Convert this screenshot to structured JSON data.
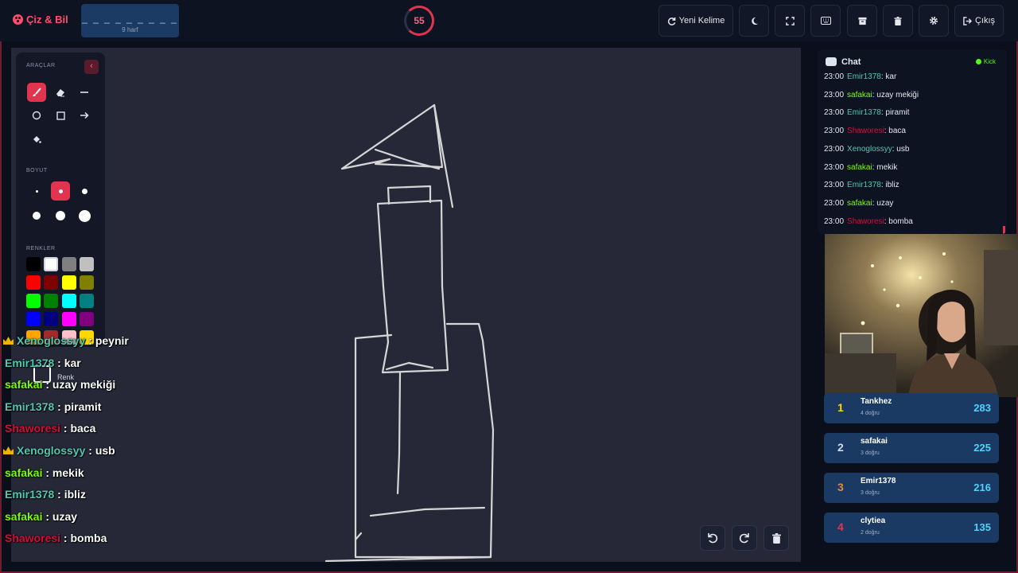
{
  "app": {
    "title": "Çiz & Bil"
  },
  "word": {
    "dashes": "_ _ _ _ _ _ _ _ _",
    "count_label": "9 harf"
  },
  "timer": {
    "seconds": "55"
  },
  "header_buttons": {
    "new_word": "Yeni Kelime",
    "exit": "Çıkış"
  },
  "tools_panel": {
    "tools_label": "ARAÇLAR",
    "size_label": "BOYUT",
    "colors_label": "RENKLER",
    "color_label": "Renk",
    "active_tool": "brush-icon",
    "tools": [
      "brush-icon",
      "eraser-icon",
      "line-icon",
      "circle-icon",
      "rectangle-icon",
      "arrow-icon",
      "fill-bucket-icon"
    ],
    "active_size_index": 1,
    "swatches": [
      "#000000",
      "#ffffff",
      "#808080",
      "#c0c0c0",
      "#ff0000",
      "#800000",
      "#ffff00",
      "#808000",
      "#00ff00",
      "#008000",
      "#00ffff",
      "#008080",
      "#0000ff",
      "#000080",
      "#ff00ff",
      "#800080",
      "#ffa500",
      "#a52a2a",
      "#ffc0cb",
      "#ffd700"
    ]
  },
  "overlay_chat": [
    {
      "user": "Xenoglossyy",
      "text": ": peynir",
      "color": "#4ec9b0",
      "crown": true
    },
    {
      "user": "Emir1378",
      "text": ": kar",
      "color": "#4ec9b0",
      "crown": false
    },
    {
      "user": "safakai",
      "text": ": uzay mekiği",
      "color": "#7cfc00",
      "crown": false
    },
    {
      "user": "Emir1378",
      "text": ": piramit",
      "color": "#4ec9b0",
      "crown": false
    },
    {
      "user": "Shaworesi",
      "text": ": baca",
      "color": "#d0103a",
      "crown": false
    },
    {
      "user": "Xenoglossyy",
      "text": ": usb",
      "color": "#4ec9b0",
      "crown": true
    },
    {
      "user": "safakai",
      "text": ": mekik",
      "color": "#7cfc00",
      "crown": false
    },
    {
      "user": "Emir1378",
      "text": ": ibliz",
      "color": "#4ec9b0",
      "crown": false
    },
    {
      "user": "safakai",
      "text": ": uzay",
      "color": "#7cfc00",
      "crown": false
    },
    {
      "user": "Shaworesi",
      "text": ": bomba",
      "color": "#d0103a",
      "crown": false
    }
  ],
  "chat": {
    "title": "Chat",
    "platform": "Kick",
    "messages": [
      {
        "time": "23:00",
        "user": "Emir1378",
        "text": ": kar",
        "color": "#4ec9b0"
      },
      {
        "time": "23:00",
        "user": "safakai",
        "text": ": uzay mekiği",
        "color": "#7cfc00"
      },
      {
        "time": "23:00",
        "user": "Emir1378",
        "text": ": piramit",
        "color": "#4ec9b0"
      },
      {
        "time": "23:00",
        "user": "Shaworesi",
        "text": ": baca",
        "color": "#d0103a"
      },
      {
        "time": "23:00",
        "user": "Xenoglossyy",
        "text": ": usb",
        "color": "#4ec9b0"
      },
      {
        "time": "23:00",
        "user": "safakai",
        "text": ": mekik",
        "color": "#7cfc00"
      },
      {
        "time": "23:00",
        "user": "Emir1378",
        "text": ": ibliz",
        "color": "#4ec9b0"
      },
      {
        "time": "23:00",
        "user": "safakai",
        "text": ": uzay",
        "color": "#7cfc00"
      },
      {
        "time": "23:00",
        "user": "Shaworesi",
        "text": ": bomba",
        "color": "#d0103a"
      }
    ]
  },
  "leaderboard": [
    {
      "rank": "1",
      "name": "Tankhez",
      "sub": "4 doğru",
      "score": "283",
      "rank_color": "#ffd60a"
    },
    {
      "rank": "2",
      "name": "safakai",
      "sub": "3 doğru",
      "score": "225",
      "rank_color": "#d7dde8"
    },
    {
      "rank": "3",
      "name": "Emir1378",
      "sub": "3 doğru",
      "score": "216",
      "rank_color": "#e08a3c"
    },
    {
      "rank": "4",
      "name": "clytiea",
      "sub": "2 doğru",
      "score": "135",
      "rank_color": "#e0344f"
    }
  ],
  "colors": {
    "accent": "#e0344f",
    "background": "#0b0f1c",
    "canvas": "#262838",
    "panel": "#141826"
  }
}
